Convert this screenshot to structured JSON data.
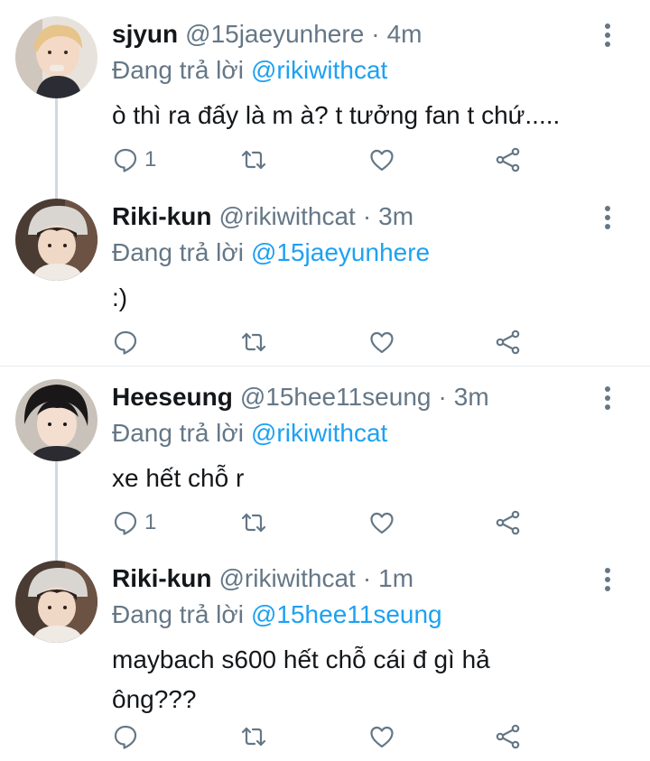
{
  "replying_label": "Đang trả lời",
  "colors": {
    "link": "#1da1f2",
    "secondary": "#657786",
    "text": "#14171a",
    "thread_line": "#cfd9de"
  },
  "tweets": [
    {
      "name": "sjyun",
      "handle": "@15jaeyunhere",
      "separator": "·",
      "time": "4m",
      "replying_to": "@rikiwithcat",
      "text": "ò thì ra đấy là m à? t tưởng fan t chứ.....",
      "reply_count": "1",
      "avatar_icon": "profile-photo-blond-hair"
    },
    {
      "name": "Riki-kun",
      "handle": "@rikiwithcat",
      "separator": "·",
      "time": "3m",
      "replying_to": "@15jaeyunhere",
      "text": ":)",
      "reply_count": "",
      "avatar_icon": "profile-photo-beanie"
    },
    {
      "name": "Heeseung",
      "handle": "@15hee11seung",
      "separator": "·",
      "time": "3m",
      "replying_to": "@rikiwithcat",
      "text": "xe hết chỗ r",
      "reply_count": "1",
      "avatar_icon": "profile-photo-dark-hair"
    },
    {
      "name": "Riki-kun",
      "handle": "@rikiwithcat",
      "separator": "·",
      "time": "1m",
      "replying_to": "@15hee11seung",
      "text": "maybach s600 hết chỗ cái đ gì hả ông???",
      "reply_count": "",
      "avatar_icon": "profile-photo-beanie"
    }
  ]
}
